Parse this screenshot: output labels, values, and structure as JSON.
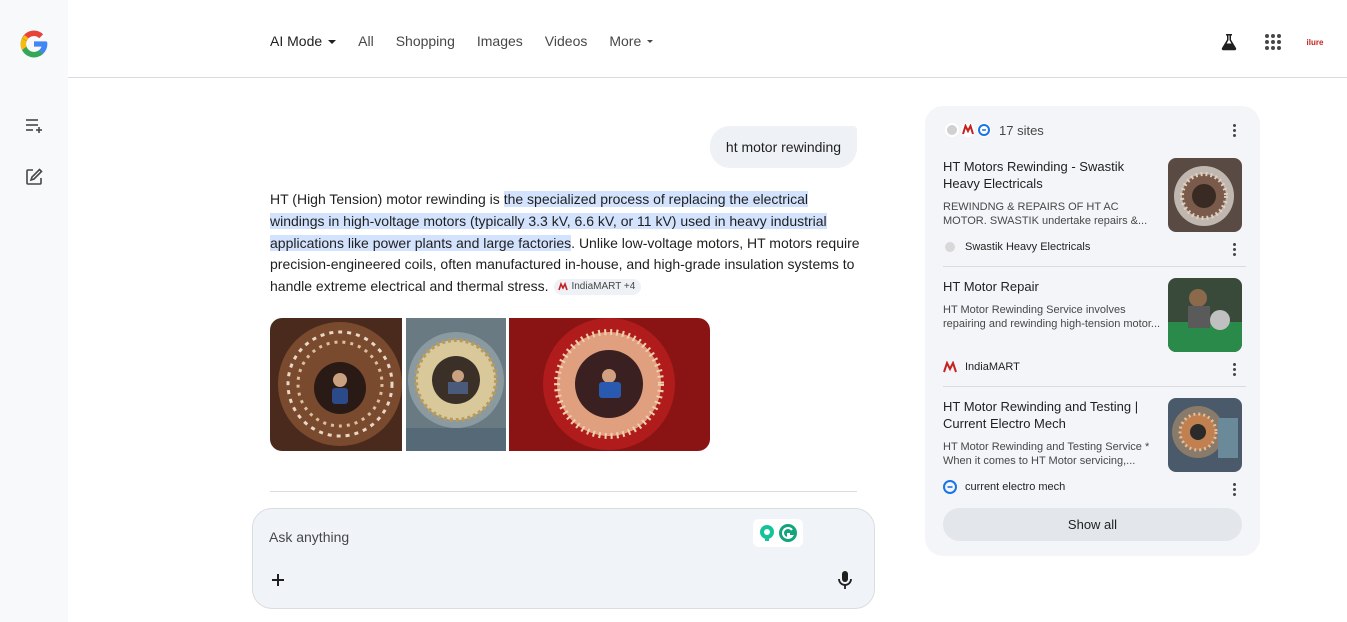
{
  "nav": {
    "tabs": [
      {
        "label": "AI Mode"
      },
      {
        "label": "All"
      },
      {
        "label": "Shopping"
      },
      {
        "label": "Images"
      },
      {
        "label": "Videos"
      },
      {
        "label": "More"
      }
    ],
    "avatar_text": "ilure"
  },
  "chat": {
    "query": "ht motor rewinding",
    "answer": {
      "intro": "HT (High Tension) motor rewinding is ",
      "highlight": "the specialized process of replacing the electrical windings in high-voltage motors (typically 3.3 kV, 6.6 kV, or 11 kV) used in heavy industrial applications like power plants and large factories",
      "rest": ". Unlike low-voltage motors, HT motors require precision-engineered coils, often manufactured in-house, and high-grade insulation systems to handle extreme electrical and thermal stress.",
      "citation": "IndiaMART +4"
    },
    "ask_placeholder": "Ask anything"
  },
  "sources": {
    "count_label": "17 sites",
    "items": [
      {
        "title": "HT Motors Rewinding - Swastik Heavy Electricals",
        "snippet": "REWINDNG & REPAIRS OF HT AC MOTOR. SWASTIK undertake repairs &...",
        "site": "Swastik Heavy Electricals"
      },
      {
        "title": "HT Motor Repair",
        "snippet": "HT Motor Rewinding Service involves repairing and rewinding high-tension motor...",
        "site": "IndiaMART"
      },
      {
        "title": "HT Motor Rewinding and Testing | Current Electro Mech",
        "snippet": "HT Motor Rewinding and Testing Service * When it comes to HT Motor servicing,...",
        "site": "current electro mech"
      }
    ],
    "show_all_label": "Show all"
  },
  "colors": {
    "highlight": "#d3e3fd",
    "query_bubble": "#eef1f5",
    "panel": "#f3f5f8",
    "indiamart_red": "#c5221f",
    "current_blue": "#1a73e8"
  }
}
